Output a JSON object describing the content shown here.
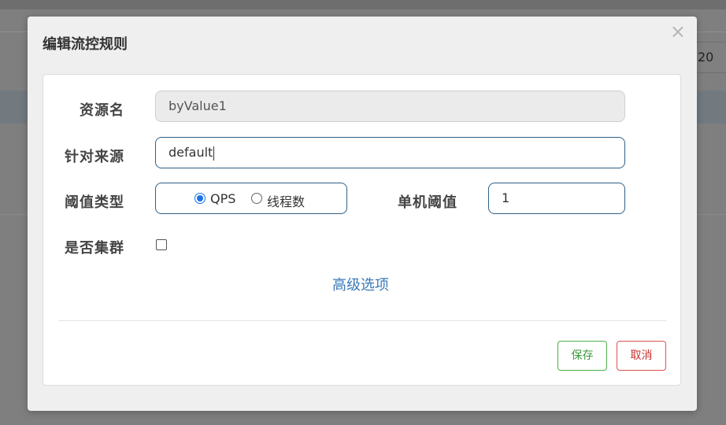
{
  "background": {
    "pager_value": "20"
  },
  "modal": {
    "title": "编辑流控规则",
    "close_glyph": "×"
  },
  "form": {
    "resource_label": "资源名",
    "resource_value": "byValue1",
    "source_label": "针对来源",
    "source_value": "default",
    "threshold_type_label": "阈值类型",
    "threshold_type_options": [
      {
        "label": "QPS",
        "checked": true
      },
      {
        "label": "线程数",
        "checked": false
      }
    ],
    "single_threshold_label": "单机阈值",
    "single_threshold_value": "1",
    "cluster_label": "是否集群",
    "cluster_checked": false,
    "advanced_link": "高级选项"
  },
  "actions": {
    "save_label": "保存",
    "cancel_label": "取消"
  },
  "colors": {
    "input_border": "#2f5f86",
    "radio_accent": "#1a73e8",
    "link": "#3a7ab8",
    "save": "#3c9a3c",
    "cancel": "#c9302c"
  }
}
